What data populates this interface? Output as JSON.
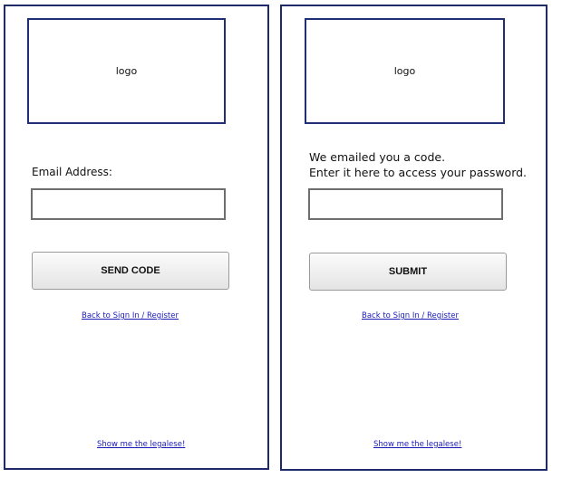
{
  "left_panel": {
    "logo_text": "logo",
    "email_label": "Email Address:",
    "email_value": "",
    "send_code_label": "SEND CODE",
    "back_link": "Back to Sign In / Register",
    "legalese_link": "Show me the legalese!"
  },
  "right_panel": {
    "logo_text": "logo",
    "message_line1": "We emailed you a code.",
    "message_line2": "Enter it here to access your password.",
    "code_value": "",
    "submit_label": "SUBMIT",
    "back_link": "Back to Sign In / Register",
    "legalese_link": "Show me the legalese!"
  },
  "colors": {
    "panel_border": "#1f2a6b",
    "link": "#1a1ab8"
  }
}
